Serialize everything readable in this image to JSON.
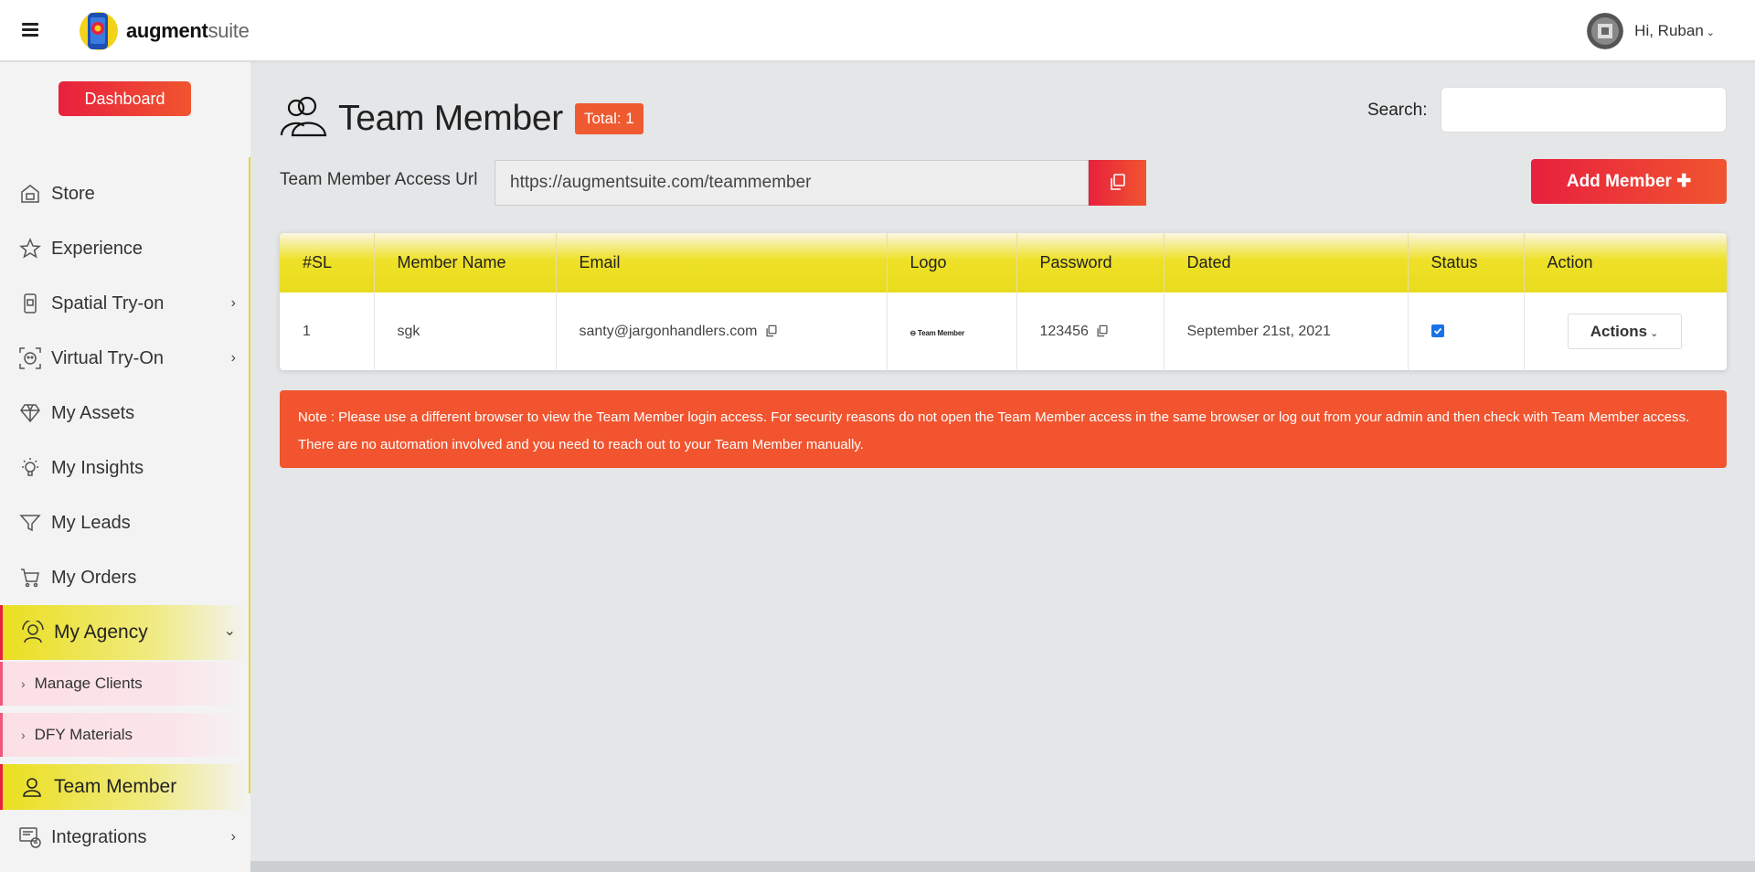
{
  "header": {
    "brand_bold": "augment",
    "brand_light": "suite",
    "user_greeting": "Hi, Ruban"
  },
  "sidebar": {
    "dashboard_label": "Dashboard",
    "items": [
      {
        "label": "Store",
        "icon": "store-icon"
      },
      {
        "label": "Experience",
        "icon": "star-icon"
      },
      {
        "label": "Spatial Try-on",
        "icon": "ar-phone-icon"
      },
      {
        "label": "Virtual Try-On",
        "icon": "face-scan-icon"
      },
      {
        "label": "My Assets",
        "icon": "diamond-icon"
      },
      {
        "label": "My Insights",
        "icon": "bulb-icon"
      },
      {
        "label": "My Leads",
        "icon": "funnel-icon"
      },
      {
        "label": "My Orders",
        "icon": "cart-icon"
      },
      {
        "label": "My Agency",
        "icon": "agency-icon"
      }
    ],
    "sub_items": [
      {
        "label": "Manage Clients"
      },
      {
        "label": "DFY Materials"
      }
    ],
    "team_member_label": "Team Member",
    "integrations_label": "Integrations",
    "accent_color": "#e8203e",
    "active_color": "#eadf20"
  },
  "main": {
    "title": "Team Member",
    "total_badge": "Total: 1",
    "search_label": "Search:",
    "search_value": "",
    "access_url_label": "Team Member Access Url",
    "access_url": "https://augmentsuite.com/teammember",
    "add_member_label": "Add Member",
    "table": {
      "headers": [
        "#SL",
        "Member Name",
        "Email",
        "Logo",
        "Password",
        "Dated",
        "Status",
        "Action"
      ],
      "rows": [
        {
          "sl": "1",
          "name": "sgk",
          "email": "santy@jargonhandlers.com",
          "logo_text": "Team Member",
          "password": "123456",
          "dated": "September 21st, 2021",
          "status_checked": true,
          "action_label": "Actions"
        }
      ]
    },
    "note": "Note : Please use a different browser to view the Team Member login access. For security reasons do not open the Team Member access in the same browser or log out from your admin and then check with Team Member access. There are no automation involved and you need to reach out to your Team Member manually."
  }
}
